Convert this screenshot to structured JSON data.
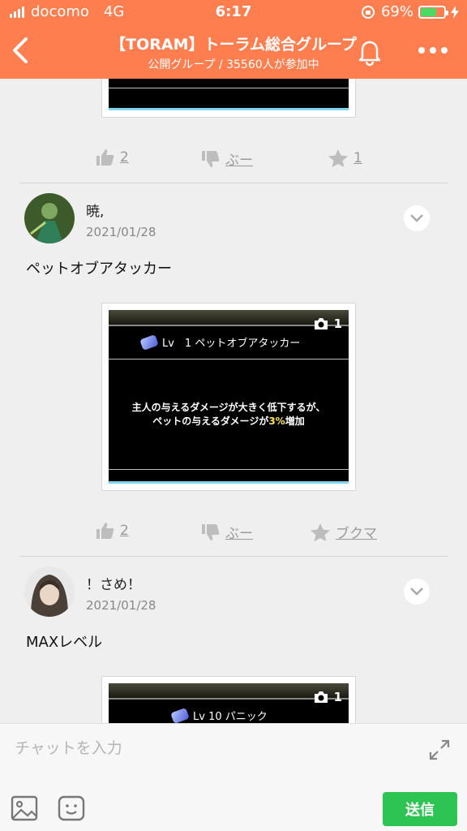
{
  "status_bar": {
    "carrier": "docomo",
    "network": "4G",
    "time": "6:17",
    "battery": "69%",
    "battery_level": 0.69
  },
  "header": {
    "title": "【TORAM】トーラム総合グループ",
    "subtitle": "公開グループ / 35560人が参加中"
  },
  "colors": {
    "header_bg": "#ff7e4f",
    "send_button": "#2ec453"
  },
  "posts": [
    {
      "likes": "2",
      "dislike_label": "ぶー",
      "bookmark": "1"
    },
    {
      "author": "暁,",
      "date": "2021/01/28",
      "text": "ペットオブアタッカー",
      "image": {
        "photo_count": "1",
        "skill_line": "Lv　1 ペットオブアタッカー",
        "desc_line1": "主人の与えるダメージが大きく低下するが、",
        "desc_line2_pre": "ペットの与えるダメージが",
        "desc_highlight": "3%",
        "desc_line2_post": "増加"
      },
      "likes": "2",
      "dislike_label": "ぶー",
      "bookmark": "ブクマ"
    },
    {
      "author": "！さめ！",
      "date": "2021/01/28",
      "text": "MAXレベル",
      "image": {
        "photo_count": "1",
        "skill_line": "Lv 10 パニック"
      }
    }
  ],
  "composer": {
    "placeholder": "チャットを入力",
    "send_label": "送信"
  },
  "icons": [
    "back-icon",
    "bell-icon",
    "more-icon",
    "thumbs-up-icon",
    "thumbs-down-icon",
    "star-icon",
    "chevron-down-icon",
    "camera-icon",
    "image-icon",
    "emoji-icon",
    "expand-icon"
  ]
}
